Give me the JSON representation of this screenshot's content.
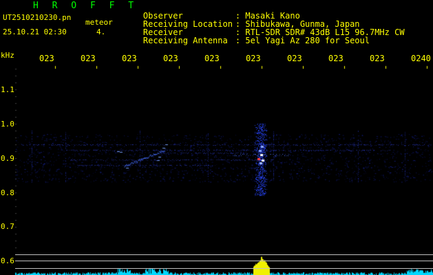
{
  "header": {
    "app_title": "H R O F F T",
    "filename": "UT2510210230.pn",
    "meteor_label": "meteor",
    "datetime": "25.10.21 02:30",
    "meteor_count": "4.",
    "rows": [
      {
        "key": "Observer",
        "value": ": Masaki Kano"
      },
      {
        "key": "Receiving Location",
        "value": ": Shibukawa, Gunma, Japan"
      },
      {
        "key": "Receiver",
        "value": ": RTL-SDR SDR# 43dB L15 96.7MHz CW"
      },
      {
        "key": "Receiving Antenna",
        "value": ": 5el Yagi Az 280 for Seoul"
      }
    ]
  },
  "axes": {
    "unit": "kHz",
    "time_ticks": [
      "023",
      "023",
      "023",
      "023",
      "023",
      "023",
      "023",
      "023",
      "023",
      "0240"
    ],
    "freq_ticks": [
      "1.1",
      "1.0",
      "0.9",
      "0.8",
      "0.7",
      "0.6"
    ]
  },
  "colors": {
    "title": "#00ff00",
    "text": "#ffff00",
    "header": "#ffff00",
    "trace": "#2a3cff",
    "meteor_core": "#ffffff",
    "bottom_spectrum": "#00e0ff"
  }
}
